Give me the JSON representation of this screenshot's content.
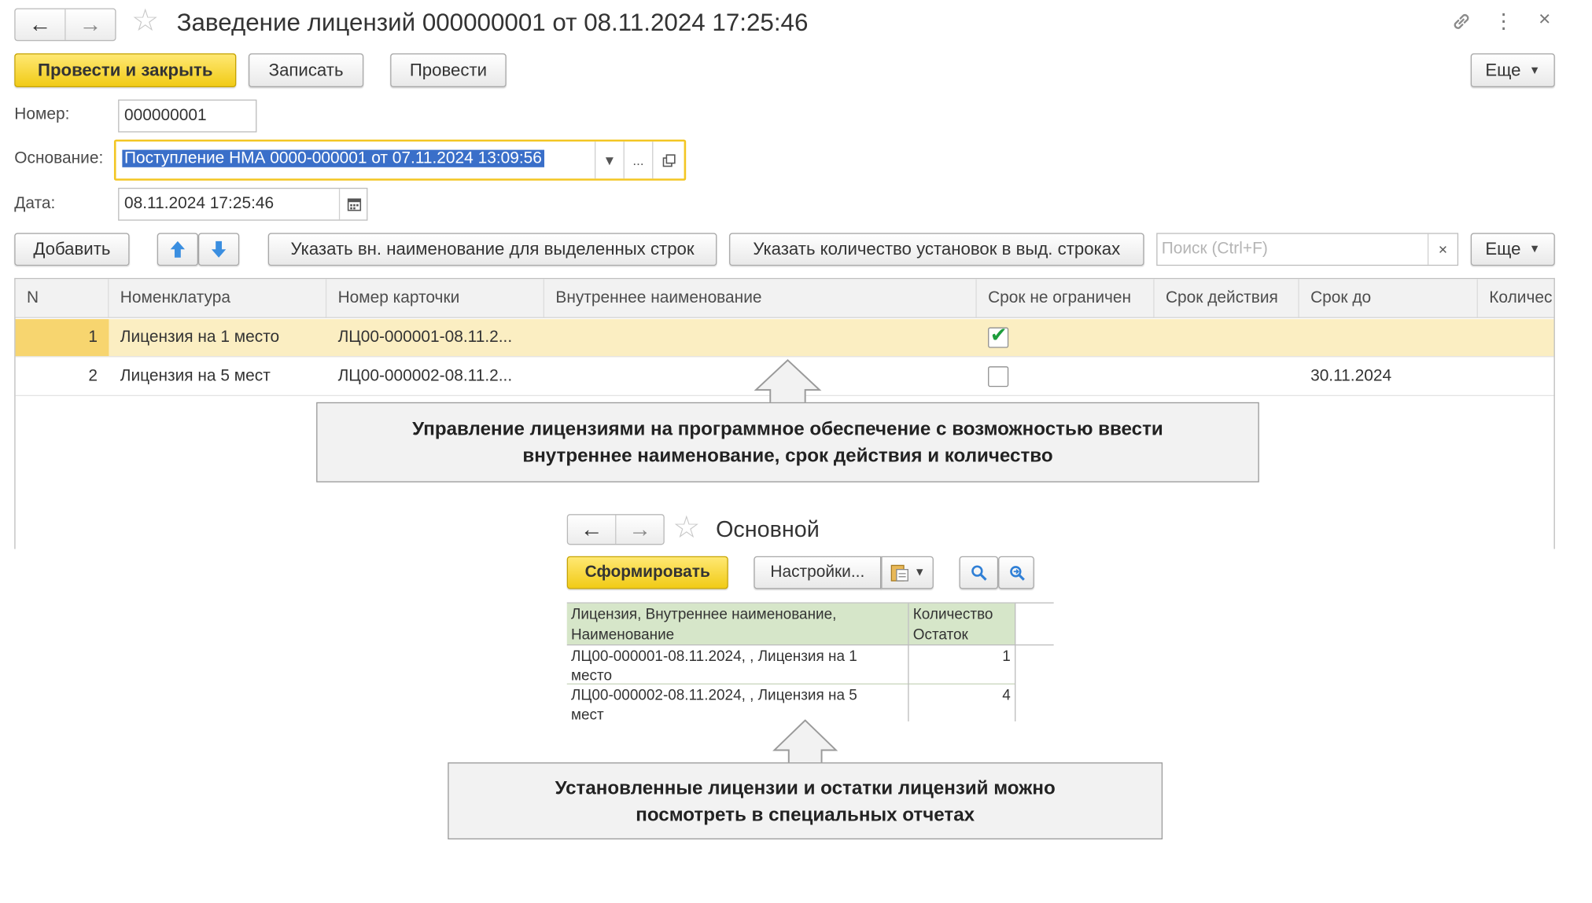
{
  "window": {
    "title": "Заведение лицензий 000000001 от 08.11.2024 17:25:46",
    "back_icon": "←",
    "forward_icon": "→",
    "favorite_icon": "☆",
    "link_icon": "🔗",
    "menu_icon": "⋮",
    "close_icon": "×"
  },
  "toolbar": {
    "post_close": "Провести и закрыть",
    "save": "Записать",
    "post": "Провести",
    "more": "Еще"
  },
  "form": {
    "number_label": "Номер:",
    "number_value": "000000001",
    "basis_label": "Основание:",
    "basis_value": "Поступление НМА 0000-000001 от 07.11.2024 13:09:56",
    "basis_more": "...",
    "date_label": "Дата:",
    "date_value": "08.11.2024 17:25:46"
  },
  "table_toolbar": {
    "add": "Добавить",
    "set_internal_name": "Указать вн. наименование для выделенных строк",
    "set_install_count": "Указать количество установок в выд. строках",
    "search_placeholder": "Поиск (Ctrl+F)",
    "search_clear": "×",
    "more": "Еще"
  },
  "table": {
    "columns": [
      "N",
      "Номенклатура",
      "Номер карточки",
      "Внутреннее наименование",
      "Срок не ограничен",
      "Срок действия",
      "Срок до",
      "Количес"
    ],
    "rows": [
      {
        "n": "1",
        "item": "Лицензия на 1 место",
        "card": "ЛЦ00-000001-08.11.2...",
        "internal": "",
        "unlimited": true,
        "term": "",
        "until": ""
      },
      {
        "n": "2",
        "item": "Лицензия на 5 мест",
        "card": "ЛЦ00-000002-08.11.2...",
        "internal": "",
        "unlimited": false,
        "term": "",
        "until": "30.11.2024"
      }
    ]
  },
  "callouts": {
    "top_line1": "Управление лицензиями на программное обеспечение с возможностью ввести",
    "top_line2": "внутреннее наименование, срок действия и количество",
    "bottom_line1": "Установленные лицензии и остатки лицензий можно",
    "bottom_line2": "посмотреть в специальных отчетах"
  },
  "report": {
    "title": "Основной",
    "generate": "Сформировать",
    "settings": "Настройки...",
    "header_col1_line1": "Лицензия, Внутреннее наименование,",
    "header_col1_line2": "Наименование",
    "header_col2_line1": "Количество",
    "header_col2_line2": "Остаток",
    "rows": [
      {
        "line1": "ЛЦ00-000001-08.11.2024, , Лицензия на 1",
        "line2": "место",
        "qty": "1"
      },
      {
        "line1": "ЛЦ00-000002-08.11.2024, , Лицензия на 5",
        "line2": "мест",
        "qty": "4"
      }
    ]
  },
  "colors": {
    "primary_button": "#f1cb16",
    "selected_row": "#fbeec2",
    "selection_highlight": "#3a6fc9",
    "report_header": "#d6e6c9",
    "checkmark": "#1d9d3c"
  }
}
